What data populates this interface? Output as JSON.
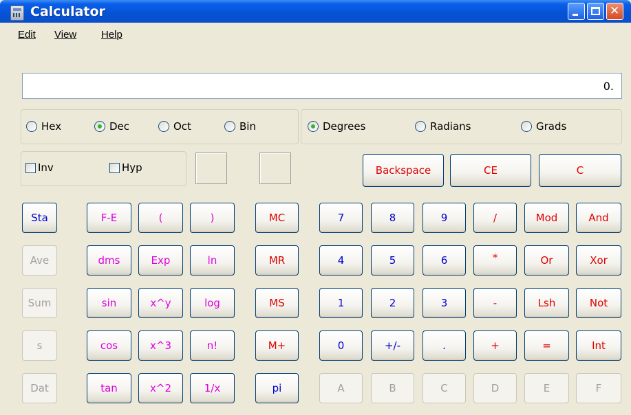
{
  "window": {
    "title": "Calculator"
  },
  "menu": {
    "edit": "Edit",
    "view": "View",
    "help": "Help"
  },
  "display": {
    "value": "0."
  },
  "number_base": {
    "hex": "Hex",
    "dec": "Dec",
    "oct": "Oct",
    "bin": "Bin",
    "selected": "Dec"
  },
  "angle_mode": {
    "degrees": "Degrees",
    "radians": "Radians",
    "grads": "Grads",
    "selected": "Degrees"
  },
  "checks": {
    "inv": "Inv",
    "hyp": "Hyp"
  },
  "edit_buttons": {
    "backspace": "Backspace",
    "ce": "CE",
    "c": "C"
  },
  "stat_buttons": [
    "Sta",
    "Ave",
    "Sum",
    "s",
    "Dat"
  ],
  "func_col1": [
    "F-E",
    "dms",
    "sin",
    "cos",
    "tan"
  ],
  "func_col2": [
    "(",
    "Exp",
    "x^y",
    "x^3",
    "x^2"
  ],
  "func_col3": [
    ")",
    "ln",
    "log",
    "n!",
    "1/x"
  ],
  "memory_buttons": [
    "MC",
    "MR",
    "MS",
    "M+",
    "pi"
  ],
  "digit_rows": [
    [
      "7",
      "8",
      "9",
      "/",
      "Mod",
      "And"
    ],
    [
      "4",
      "5",
      "6",
      "*",
      "Or",
      "Xor"
    ],
    [
      "1",
      "2",
      "3",
      "-",
      "Lsh",
      "Not"
    ],
    [
      "0",
      "+/-",
      ".",
      "+",
      "=",
      "Int"
    ],
    [
      "A",
      "B",
      "C",
      "D",
      "E",
      "F"
    ]
  ],
  "colors": {
    "digits": "#0000cc",
    "functions": "#e000e0",
    "memory": "#e00000",
    "disabled": "#a0a0a0"
  }
}
